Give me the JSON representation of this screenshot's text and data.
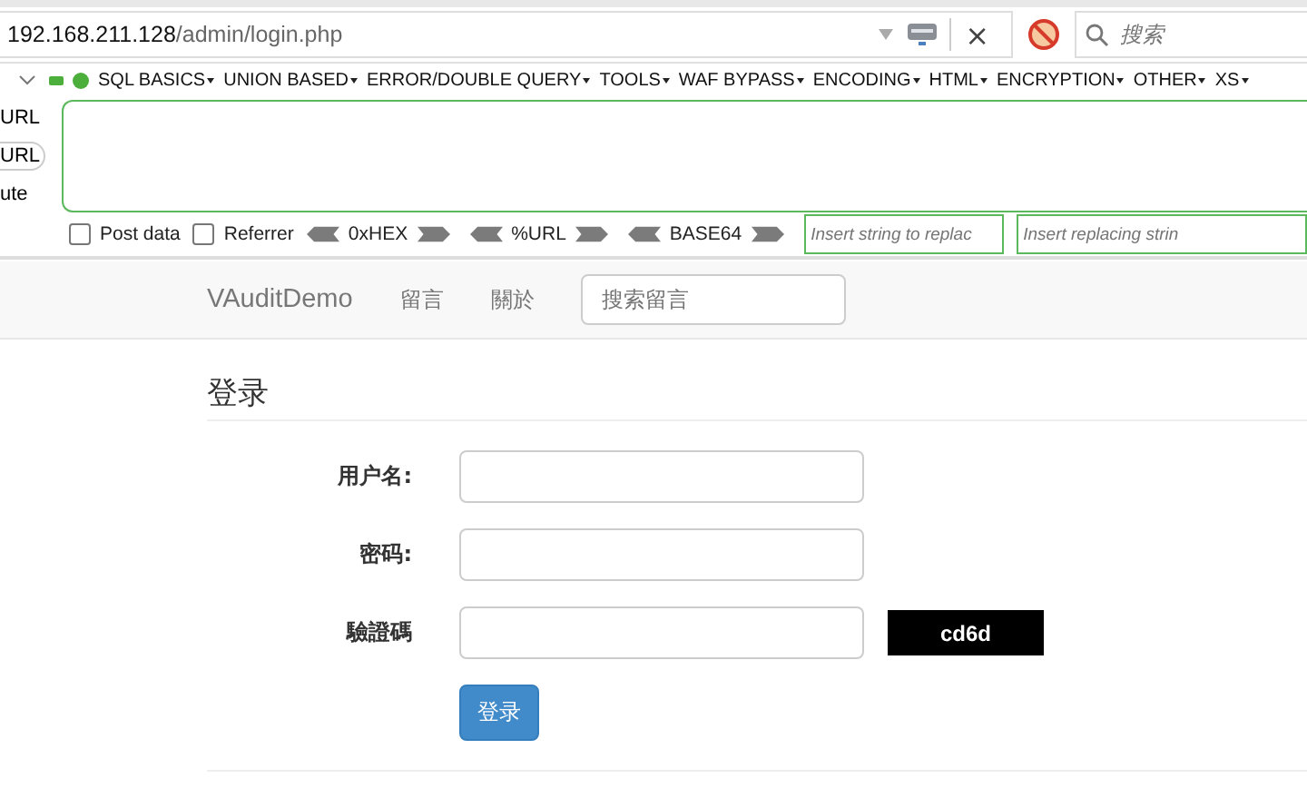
{
  "address_bar": {
    "url_host": "192.168.211.128",
    "url_path": "/admin/login.php",
    "close": "×"
  },
  "search": {
    "placeholder": "搜索"
  },
  "hackbar": {
    "menus": [
      "SQL BASICS",
      "UNION BASED",
      "ERROR/DOUBLE QUERY",
      "TOOLS",
      "WAF BYPASS",
      "ENCODING",
      "HTML",
      "ENCRYPTION",
      "OTHER",
      "XS"
    ],
    "side_buttons": [
      {
        "label": "URL",
        "kind": "plain"
      },
      {
        "label": "URL",
        "kind": "framed"
      },
      {
        "label": "ute",
        "kind": "plain"
      }
    ],
    "options": [
      {
        "label": "Post data",
        "checked": false
      },
      {
        "label": "Referrer",
        "checked": false
      }
    ],
    "encoders": [
      "0xHEX",
      "%URL",
      "BASE64"
    ],
    "replace_fields": [
      {
        "placeholder": "Insert string to replac"
      },
      {
        "placeholder": "Insert replacing strin"
      }
    ]
  },
  "navbar": {
    "brand": "VAuditDemo",
    "links": [
      "留言",
      "關於"
    ],
    "search_placeholder": "搜索留言"
  },
  "login": {
    "heading": "登录",
    "fields": [
      {
        "label": "用户名:",
        "kind": "text"
      },
      {
        "label": "密码:",
        "kind": "text"
      },
      {
        "label": "驗證碼",
        "kind": "captcha",
        "captcha": "cd6d"
      }
    ],
    "submit": "登录"
  }
}
